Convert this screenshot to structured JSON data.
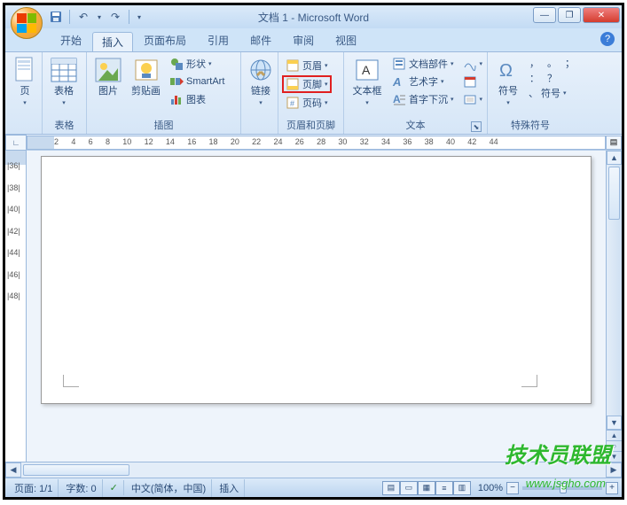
{
  "window": {
    "title": "文档 1 - Microsoft Word",
    "controls": {
      "minimize": "—",
      "maximize": "❐",
      "close": "✕"
    }
  },
  "qat": {
    "save": "💾",
    "undo": "↶",
    "redo": "↷"
  },
  "tabs": {
    "items": [
      "开始",
      "插入",
      "页面布局",
      "引用",
      "邮件",
      "审阅",
      "视图"
    ],
    "active_index": 1
  },
  "ribbon": {
    "groups": {
      "pages": {
        "label": "页",
        "cover": "页"
      },
      "tables": {
        "label": "表格",
        "btn": "表格"
      },
      "illustrations": {
        "label": "插图",
        "picture": "图片",
        "clipart": "剪贴画",
        "shapes": "形状",
        "smartart": "SmartArt",
        "chart": "图表"
      },
      "links": {
        "label": "",
        "btn": "链接"
      },
      "header_footer": {
        "label": "页眉和页脚",
        "header": "页眉",
        "footer": "页脚",
        "page_number": "页码"
      },
      "text": {
        "label": "文本",
        "textbox": "文本框",
        "quickparts": "文档部件",
        "wordart": "艺术字",
        "dropcap": "首字下沉"
      },
      "symbols": {
        "label": "特殊符号",
        "symbol": "符号",
        "items": [
          "，",
          "。",
          "；",
          "：",
          "？",
          "、",
          "符号"
        ]
      }
    }
  },
  "ruler": {
    "h": [
      "2",
      "4",
      "6",
      "8",
      "10",
      "12",
      "14",
      "16",
      "18",
      "20",
      "22",
      "24",
      "26",
      "28",
      "30",
      "32",
      "34",
      "36",
      "38",
      "40",
      "42",
      "44"
    ],
    "v": [
      "|36|",
      "|38|",
      "|40|",
      "|42|",
      "|44|",
      "|46|",
      "|48|"
    ]
  },
  "status": {
    "page": "页面: 1/1",
    "words": "字数: 0",
    "proofing": "✓",
    "language": "中文(简体，中国)",
    "mode": "插入",
    "zoom_pct": "100%"
  },
  "watermark": {
    "text": "技术员联盟",
    "url": "www.jsgho.com"
  }
}
